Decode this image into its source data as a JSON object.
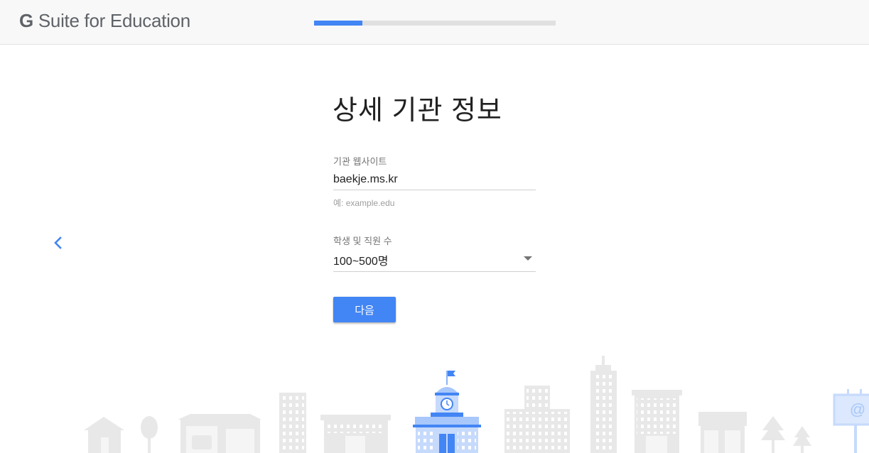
{
  "header": {
    "logo_g": "G",
    "logo_text": "Suite for Education",
    "progress_fraction": 0.2
  },
  "page": {
    "title": "상세 기관 정보"
  },
  "form": {
    "website_label": "기관 웹사이트",
    "website_value": "baekje.ms.kr",
    "website_hint": "예: example.edu",
    "size_label": "학생 및 직원 수",
    "size_value": "100~500명",
    "next_button": "다음"
  },
  "icons": {
    "back": "chevron-left-icon",
    "dropdown": "caret-down-icon",
    "billboard_symbol": "@"
  },
  "colors": {
    "accent": "#4285f4",
    "illustration_gray": "#e8e8e8",
    "school_blue": "#a8c7fa"
  }
}
